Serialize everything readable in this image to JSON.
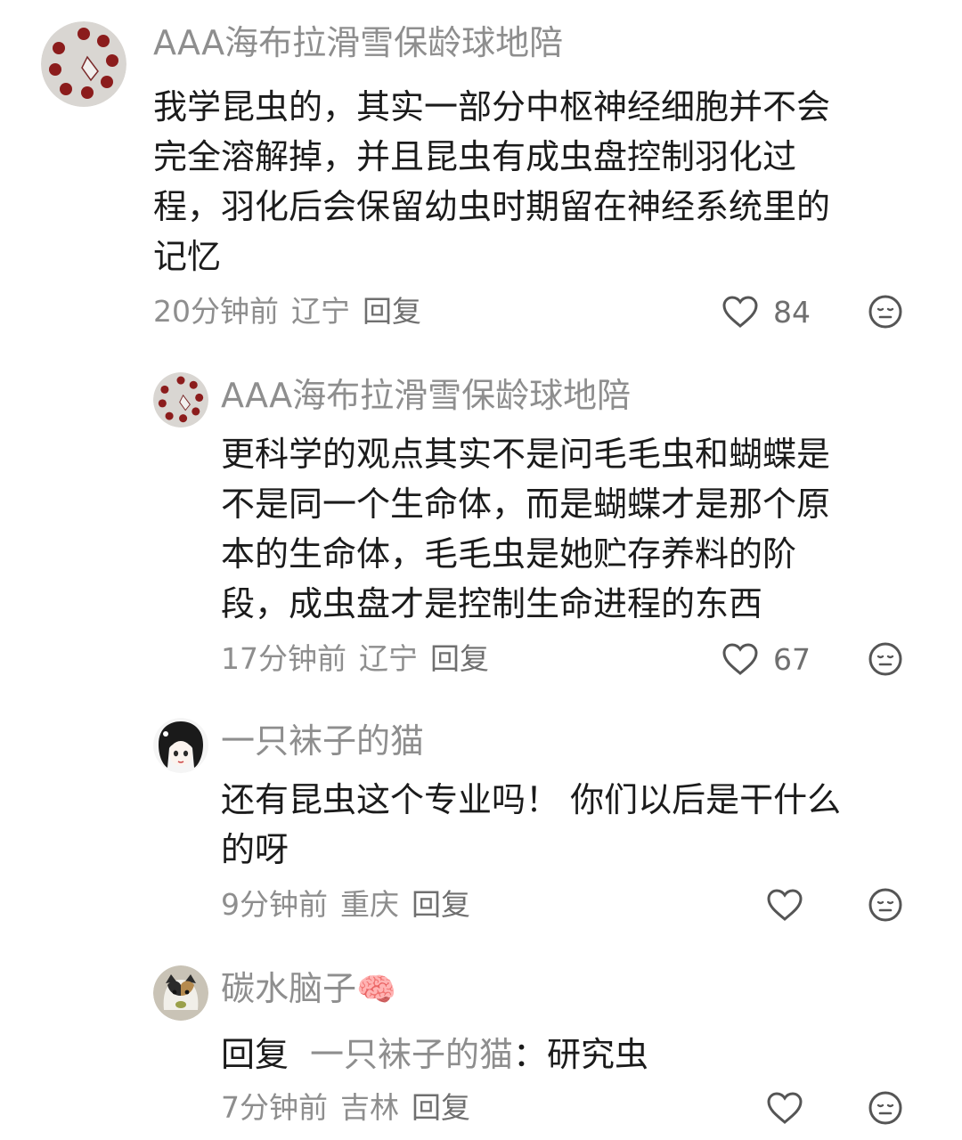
{
  "comments": [
    {
      "username": "AAA海布拉滑雪保龄球地陪",
      "lines": [
        "我学昆虫的，其实一部分中枢神经细胞并不会",
        "完全溶解掉，并且昆虫有成虫盘控制羽化过",
        "程，羽化后会保留幼虫时期留在神经系统里的",
        "记忆"
      ],
      "time": "20分钟前",
      "location": "辽宁",
      "reply_label": "回复",
      "likes": "84",
      "avatar_icon": "strawberry-ring-avatar"
    },
    {
      "username": "AAA海布拉滑雪保龄球地陪",
      "lines": [
        "更科学的观点其实不是问毛毛虫和蝴蝶是",
        "不是同一个生命体，而是蝴蝶才是那个原",
        "本的生命体，毛毛虫是她贮存养料的阶",
        "段，成虫盘才是控制生命进程的东西"
      ],
      "time": "17分钟前",
      "location": "辽宁",
      "reply_label": "回复",
      "likes": "67",
      "avatar_icon": "strawberry-ring-avatar"
    },
    {
      "username": "一只袜子的猫",
      "lines": [
        "还有昆虫这个专业吗！ 你们以后是干什么",
        "的呀"
      ],
      "time": "9分钟前",
      "location": "重庆",
      "reply_label": "回复",
      "likes": "",
      "avatar_icon": "anime-girl-avatar"
    },
    {
      "username": "碳水脑子",
      "username_emoji": "🧠",
      "reply_prefix": "回复",
      "reply_target": "一只袜子的猫",
      "reply_text": "研究虫",
      "time": "7分钟前",
      "location": "吉林",
      "reply_label": "回复",
      "likes": "",
      "avatar_icon": "kitten-avatar"
    }
  ],
  "colors": {
    "meta": "#8e8e8e",
    "text": "#1b1b1b",
    "icon": "#555555"
  }
}
